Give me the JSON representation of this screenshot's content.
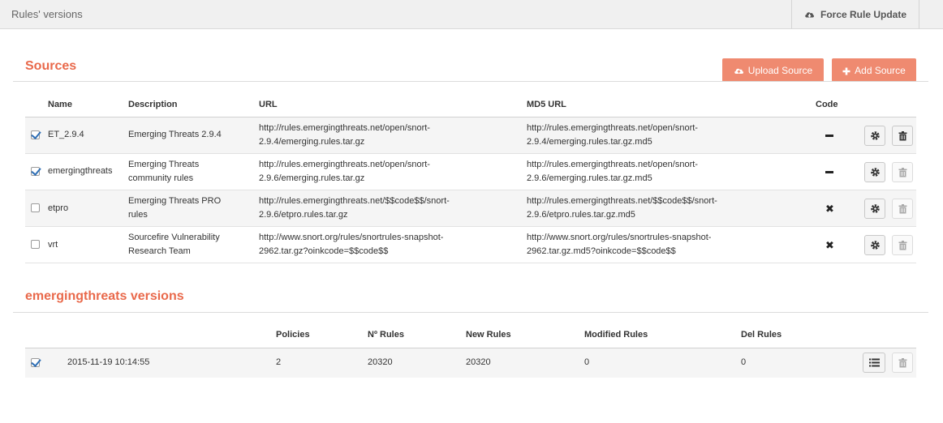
{
  "header": {
    "title": "Rules' versions",
    "force_label": "Force Rule Update"
  },
  "sources": {
    "title": "Sources",
    "upload_label": "Upload Source",
    "add_label": "Add Source",
    "columns": [
      "Name",
      "Description",
      "URL",
      "MD5 URL",
      "Code"
    ],
    "rows": [
      {
        "checked": true,
        "name": "ET_2.9.4",
        "description": [
          "Emerging Threats 2.9.4"
        ],
        "url": [
          "http://rules.emergingthreats.net/open/snort-",
          "2.9.4/emerging.rules.tar.gz"
        ],
        "md5": [
          "http://rules.emergingthreats.net/open/snort-",
          "2.9.4/emerging.rules.tar.gz.md5"
        ],
        "code": "dash",
        "delete_enabled": true
      },
      {
        "checked": true,
        "name": "emergingthreats",
        "description": [
          "Emerging Threats",
          "community rules"
        ],
        "url": [
          "http://rules.emergingthreats.net/open/snort-",
          "2.9.6/emerging.rules.tar.gz"
        ],
        "md5": [
          "http://rules.emergingthreats.net/open/snort-",
          "2.9.6/emerging.rules.tar.gz.md5"
        ],
        "code": "dash",
        "delete_enabled": false
      },
      {
        "checked": false,
        "name": "etpro",
        "description": [
          "Emerging Threats PRO",
          "rules"
        ],
        "url": [
          "http://rules.emergingthreats.net/$$code$$/snort-",
          "2.9.6/etpro.rules.tar.gz"
        ],
        "md5": [
          "http://rules.emergingthreats.net/$$code$$/snort-",
          "2.9.6/etpro.rules.tar.gz.md5"
        ],
        "code": "cross",
        "delete_enabled": false
      },
      {
        "checked": false,
        "name": "vrt",
        "description": [
          "Sourcefire Vulnerability",
          "Research Team"
        ],
        "url": [
          "http://www.snort.org/rules/snortrules-snapshot-",
          "2962.tar.gz?oinkcode=$$code$$"
        ],
        "md5": [
          "http://www.snort.org/rules/snortrules-snapshot-",
          "2962.tar.gz.md5?oinkcode=$$code$$"
        ],
        "code": "cross",
        "delete_enabled": false
      }
    ]
  },
  "versions": {
    "title": "emergingthreats versions",
    "columns": [
      "Policies",
      "Nº Rules",
      "New Rules",
      "Modified Rules",
      "Del Rules"
    ],
    "rows": [
      {
        "checked": true,
        "date": "2015-11-19 10:14:55",
        "policies": "2",
        "n_rules": "20320",
        "new_rules": "20320",
        "modified_rules": "0",
        "del_rules": "0"
      }
    ]
  },
  "icons": {
    "cloud": "cloud-download-icon",
    "upload": "cloud-upload-icon",
    "plus": "plus-icon",
    "gear": "gear-icon",
    "trash": "trash-icon",
    "list": "list-icon"
  },
  "colors": {
    "accent": "#e9694b",
    "button": "#ef8a70"
  }
}
